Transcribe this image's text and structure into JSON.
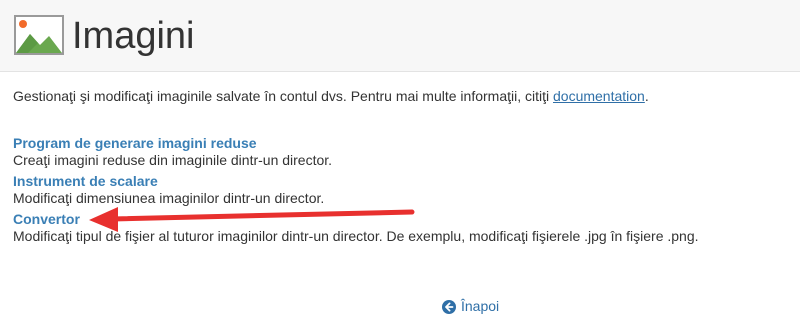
{
  "header": {
    "title": "Imagini",
    "icon": "image-landscape-icon"
  },
  "intro": {
    "text_before": "Gestionaţi şi modificaţi imaginile salvate în contul dvs. Pentru mai multe informaţii, citiţi ",
    "link_label": "documentation",
    "text_after": "."
  },
  "tools": [
    {
      "title": "Program de generare imagini reduse",
      "description": "Creaţi imagini reduse din imaginile dintr-un director."
    },
    {
      "title": "Instrument de scalare",
      "description": "Modificaţi dimensiunea imaginilor dintr-un director."
    },
    {
      "title": "Convertor",
      "description": "Modificaţi tipul de fişier al tuturor imaginilor dintr-un director. De exemplu, modificaţi fişierele .jpg în fişiere .png."
    }
  ],
  "annotation": {
    "icon": "red-arrow-icon",
    "color": "#e8302e"
  },
  "footer": {
    "back_label": "Înapoi",
    "back_icon": "circle-arrow-left-icon"
  },
  "colors": {
    "link": "#2f6fa7",
    "tool_title": "#3a7fb5",
    "icon_green": "#6aa84f",
    "icon_sun": "#f26b2a"
  }
}
